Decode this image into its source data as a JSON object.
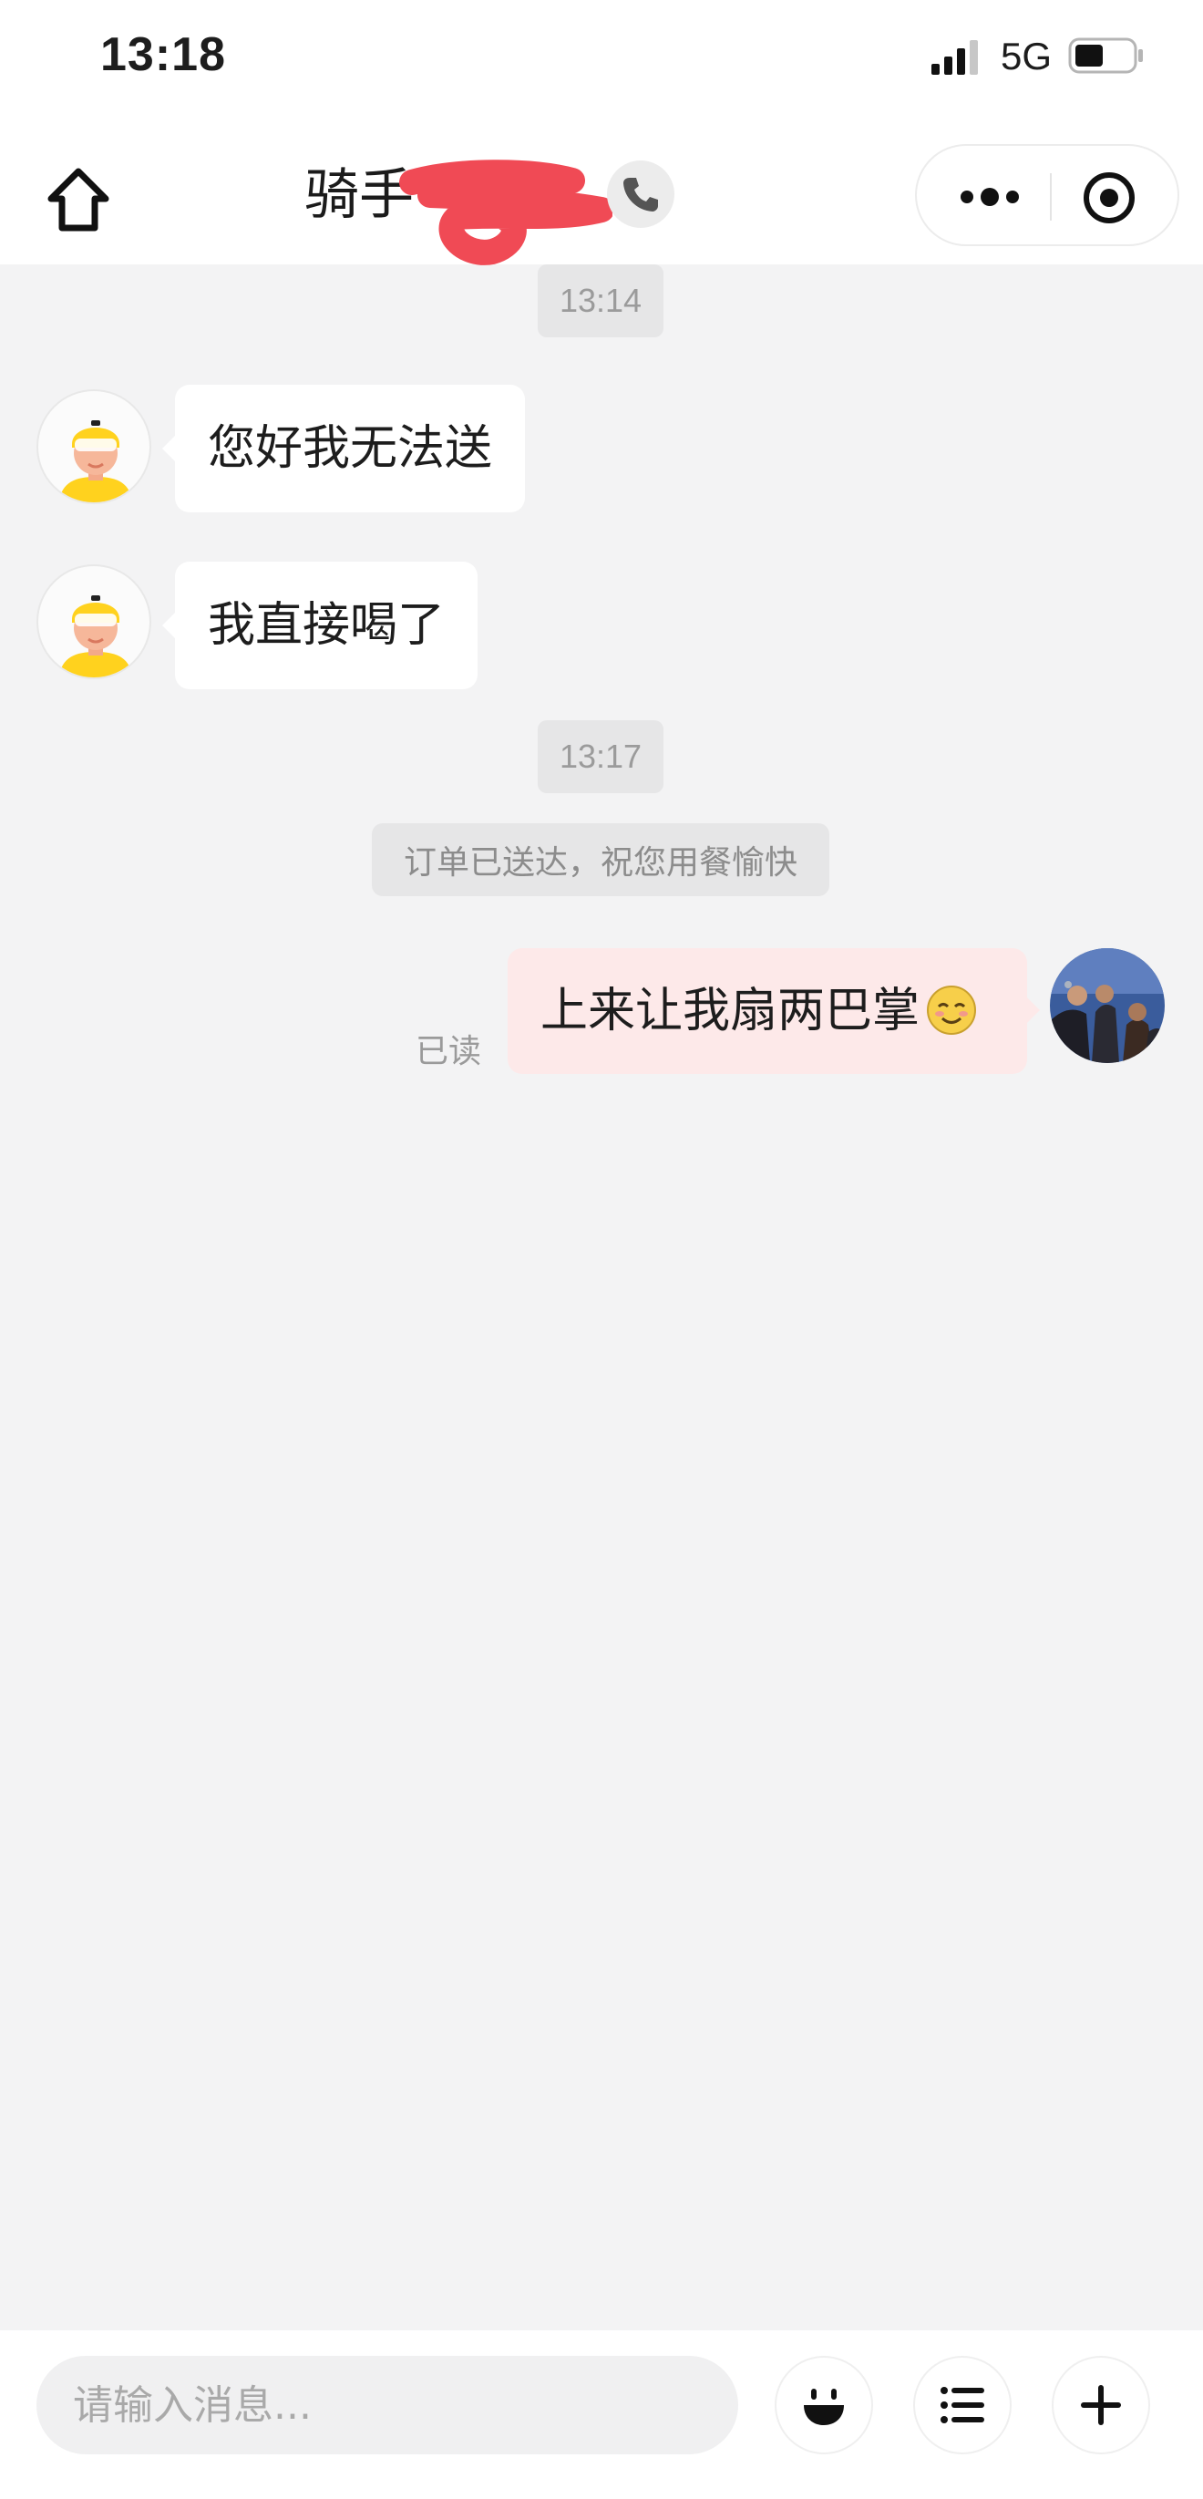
{
  "status_bar": {
    "time": "13:18",
    "network": "5G"
  },
  "nav": {
    "title": "骑手",
    "icons": {
      "home": "home-icon",
      "call": "phone-icon",
      "more": "more-dots-icon",
      "close": "target-circle-icon"
    }
  },
  "chat": {
    "time_1": "13:14",
    "msg_1": "您好我无法送",
    "msg_2": "我直接喝了",
    "time_2": "13:17",
    "system_note": "订单已送达，祝您用餐愉快",
    "my_msg": "上来让我扇两巴掌",
    "read_status": "已读"
  },
  "input_bar": {
    "placeholder": "请输入消息...",
    "icons": {
      "emoji": "smile-icon",
      "menu": "list-icon",
      "add": "plus-icon"
    }
  },
  "colors": {
    "background": "#f3f3f4",
    "bubble_in": "#ffffff",
    "bubble_out": "#fde9e9",
    "rider_yellow": "#ffd21e"
  }
}
